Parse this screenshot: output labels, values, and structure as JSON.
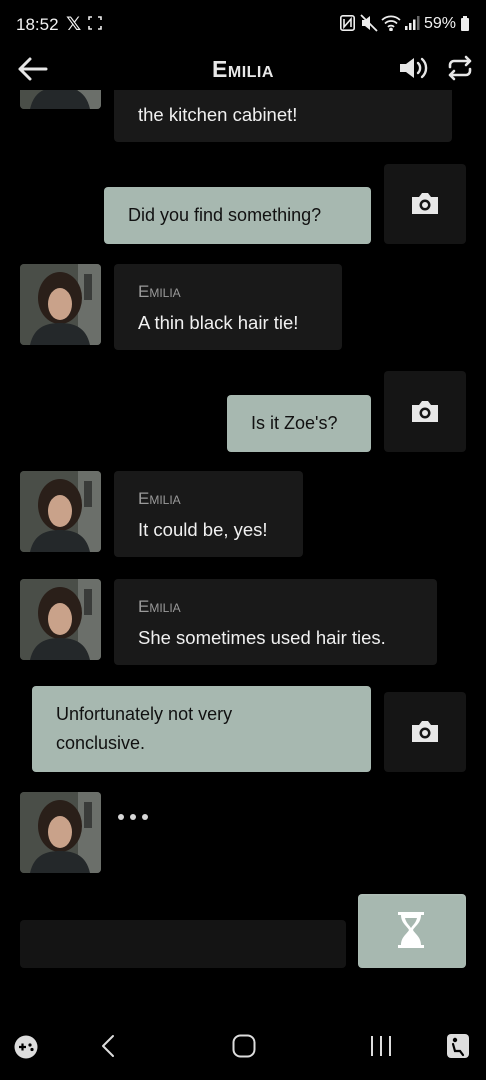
{
  "status_bar": {
    "time": "18:52",
    "x_app": "𝕏",
    "battery": "59%"
  },
  "header": {
    "title": "Emilia"
  },
  "messages": [
    {
      "from": "character",
      "sender": "",
      "text": "the kitchen cabinet!"
    },
    {
      "from": "user",
      "text": "Did you find something?"
    },
    {
      "from": "character",
      "sender": "Emilia",
      "text": "A thin black hair tie!"
    },
    {
      "from": "user",
      "text": "Is it Zoe's?"
    },
    {
      "from": "character",
      "sender": "Emilia",
      "text": "It could be, yes!"
    },
    {
      "from": "character",
      "sender": "Emilia",
      "text": "She sometimes used hair ties."
    },
    {
      "from": "user",
      "text": "Unfortunately not very conclusive."
    }
  ],
  "composer": {
    "value": "",
    "placeholder": ""
  },
  "icons": {
    "back": "arrow-left-icon",
    "sound": "speaker-icon",
    "swap": "repeat-icon",
    "camera": "camera-icon",
    "wait": "hourglass-icon"
  },
  "colors": {
    "background": "#000000",
    "user_bubble": "#a7b8b0",
    "character_bubble": "#191919",
    "sender_name": "#9a9a9a"
  }
}
